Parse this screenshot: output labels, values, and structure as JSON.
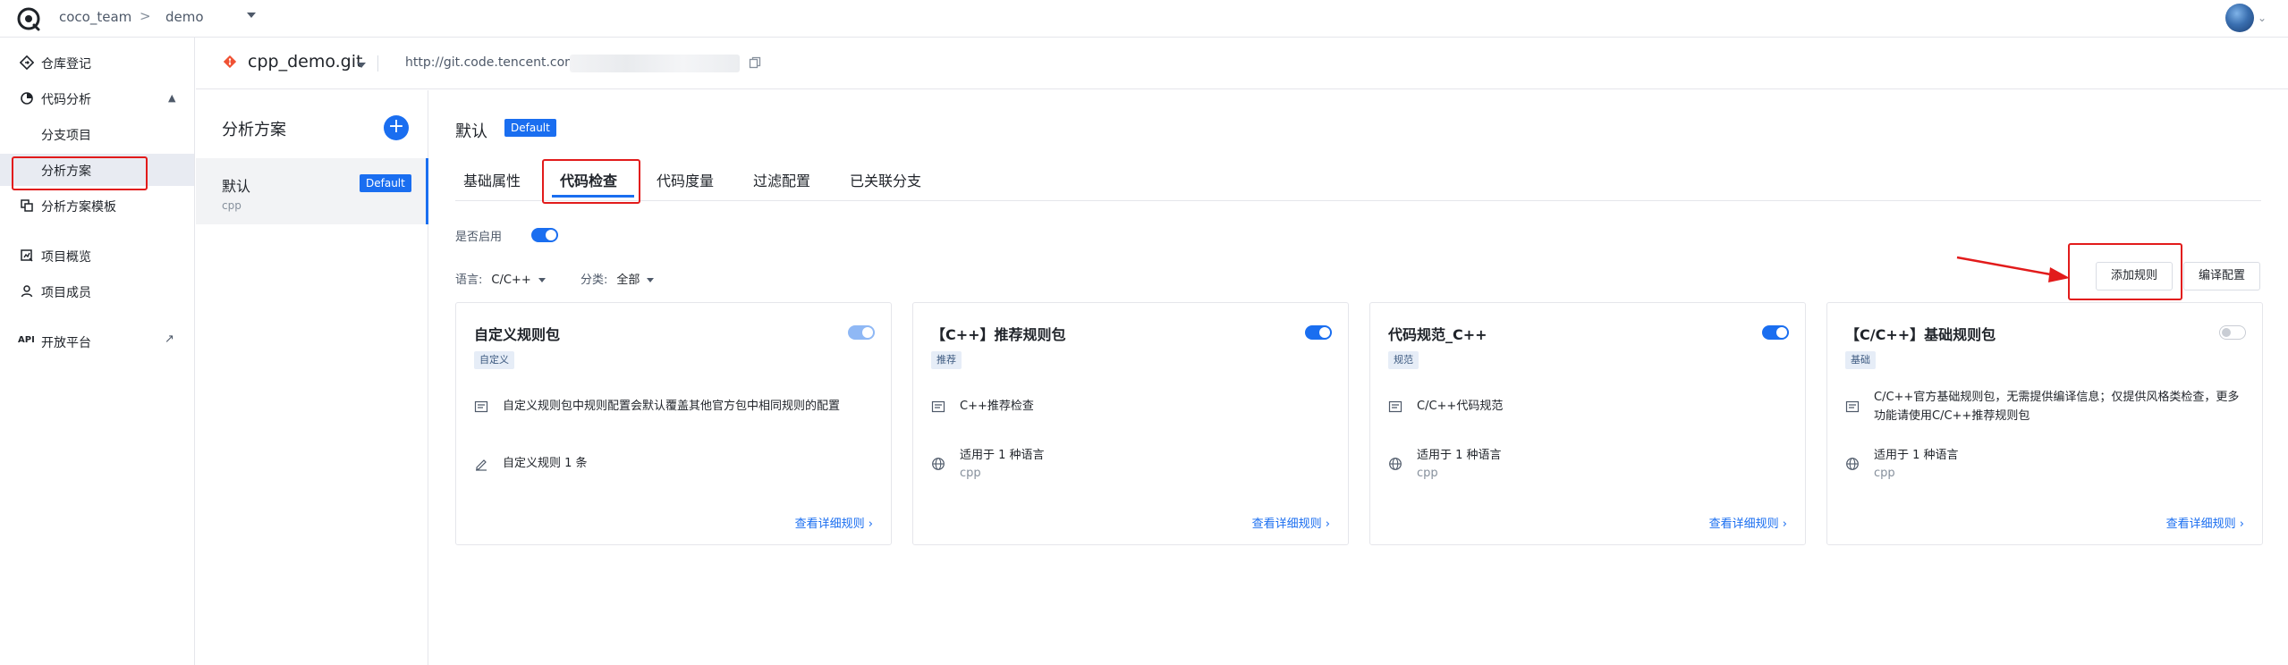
{
  "topbar": {
    "team": "coco_team",
    "separator": ">",
    "project": "demo"
  },
  "sidebar": {
    "items": [
      {
        "label": "仓库登记",
        "icon": "diamond-arrow-icon"
      },
      {
        "label": "代码分析",
        "icon": "analysis-icon"
      },
      {
        "label": "分支项目"
      },
      {
        "label": "分析方案"
      },
      {
        "label": "分析方案模板",
        "icon": "copy-template-icon"
      },
      {
        "label": "项目概览",
        "icon": "overview-icon"
      },
      {
        "label": "项目成员",
        "icon": "member-icon"
      },
      {
        "label": "开放平台",
        "icon": "external-link-icon",
        "badge": "API"
      }
    ]
  },
  "repo": {
    "name": "cpp_demo.git",
    "url": "http://git.code.tencent.com"
  },
  "schemes": {
    "title": "分析方案",
    "add_symbol": "+",
    "items": [
      {
        "name": "默认",
        "tag": "Default",
        "lang": "cpp"
      }
    ]
  },
  "main": {
    "title": "默认",
    "title_tag": "Default",
    "tabs": [
      "基础属性",
      "代码检查",
      "代码度量",
      "过滤配置",
      "已关联分支"
    ],
    "active_tab": "代码检查",
    "enable_label": "是否启用",
    "enabled": true,
    "filters": {
      "language_label": "语言:",
      "language_value": "C/C++",
      "category_label": "分类:",
      "category_value": "全部"
    },
    "buttons": {
      "add_rule": "添加规则",
      "compile_config": "编译配置"
    }
  },
  "cards": [
    {
      "title": "自定义规则包",
      "tag": "自定义",
      "enabled": true,
      "desc": "自定义规则包中规则配置会默认覆盖其他官方包中相同规则的配置",
      "line2": "自定义规则 1 条",
      "line2_sub": "",
      "link": "查看详细规则"
    },
    {
      "title": "【C++】推荐规则包",
      "tag": "推荐",
      "enabled": true,
      "desc": "C++推荐检查",
      "line2": "适用于 1 种语言",
      "line2_sub": "cpp",
      "link": "查看详细规则"
    },
    {
      "title": "代码规范_C++",
      "tag": "规范",
      "enabled": true,
      "desc": "C/C++代码规范",
      "line2": "适用于 1 种语言",
      "line2_sub": "cpp",
      "link": "查看详细规则"
    },
    {
      "title": "【C/C++】基础规则包",
      "tag": "基础",
      "enabled": false,
      "desc": "C/C++官方基础规则包，无需提供编译信息；仅提供风格类检查，更多功能请使用C/C++推荐规则包",
      "line2": "适用于 1 种语言",
      "line2_sub": "cpp",
      "link": "查看详细规则"
    }
  ],
  "colors": {
    "accent": "#1a6ef0",
    "annotation_red": "#e21b1b"
  }
}
